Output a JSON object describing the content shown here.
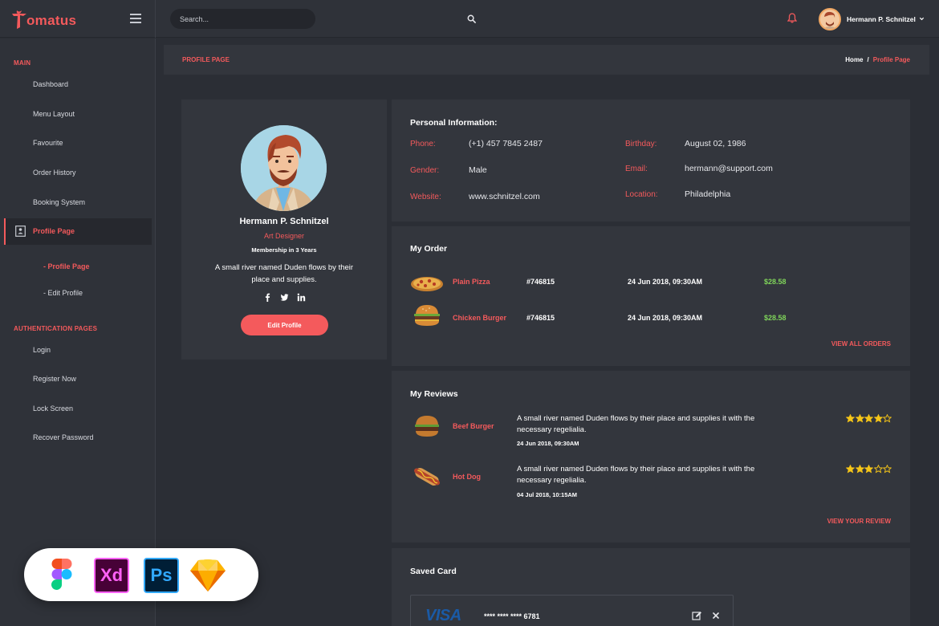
{
  "brand": {
    "logo_text": "omatus",
    "accent": "#f45a5c"
  },
  "header": {
    "search_placeholder": "Search...",
    "user_name": "Hermann P. Schnitzel"
  },
  "sidebar": {
    "section_main": "MAIN",
    "items": [
      "Dashboard",
      "Menu Layout",
      "Favourite",
      "Order History",
      "Booking System"
    ],
    "active_item": "Profile Page",
    "sub_items": [
      "- Profile Page",
      "- Edit Profile"
    ],
    "section_auth": "AUTHENTICATION PAGES",
    "auth_items": [
      "Login",
      "Register Now",
      "Lock Screen",
      "Recover Password"
    ]
  },
  "page_header": {
    "title": "PROFILE PAGE",
    "breadcrumb_home": "Home",
    "breadcrumb_sep": "/",
    "breadcrumb_current": "Profile Page"
  },
  "profile": {
    "name": "Hermann P. Schnitzel",
    "role": "Art Designer",
    "membership": "Membership in 3 Years",
    "bio": "A small river named Duden flows by their place and supplies.",
    "edit_label": "Edit Profile"
  },
  "personal_info": {
    "title": "Personal Information:",
    "fields": [
      {
        "label": "Phone:",
        "value": "(+1) 457 7845 2487"
      },
      {
        "label": "Gender:",
        "value": "Male"
      },
      {
        "label": "Website:",
        "value": "www.schnitzel.com"
      },
      {
        "label": "Birthday:",
        "value": "August 02, 1986"
      },
      {
        "label": "Email:",
        "value": "hermann@support.com"
      },
      {
        "label": "Location:",
        "value": "Philadelphia"
      }
    ]
  },
  "orders": {
    "title": "My Order",
    "rows": [
      {
        "name": "Plain Pizza",
        "id": "#746815",
        "date": "24 Jun 2018, 09:30AM",
        "price": "$28.58",
        "icon": "pizza-icon"
      },
      {
        "name": "Chicken Burger",
        "id": "#746815",
        "date": "24 Jun 2018, 09:30AM",
        "price": "$28.58",
        "icon": "burger-icon"
      }
    ],
    "link": "VIEW ALL ORDERS"
  },
  "reviews": {
    "title": "My Reviews",
    "rows": [
      {
        "name": "Beef Burger",
        "text": "A small river named Duden flows by their place and supplies it with the necessary regelialia.",
        "date": "24 Jun 2018, 09:30AM",
        "rating": 4,
        "icon": "burger-icon"
      },
      {
        "name": "Hot Dog",
        "text": "A small river named Duden flows by their place and supplies it with the necessary regelialia.",
        "date": "04 Jul 2018, 10:15AM",
        "rating": 3,
        "icon": "hotdog-icon"
      }
    ],
    "link": "VIEW YOUR REVIEW"
  },
  "saved_card": {
    "title": "Saved Card",
    "brand": "VISA",
    "number": "**** **** **** 6781"
  },
  "tools": [
    "figma-icon",
    "adobe-xd-icon",
    "photoshop-icon",
    "sketch-icon"
  ],
  "tool_labels": {
    "xd": "Xd",
    "ps": "Ps"
  },
  "colors": {
    "price": "#7fd45a",
    "star": "#f5c518"
  }
}
